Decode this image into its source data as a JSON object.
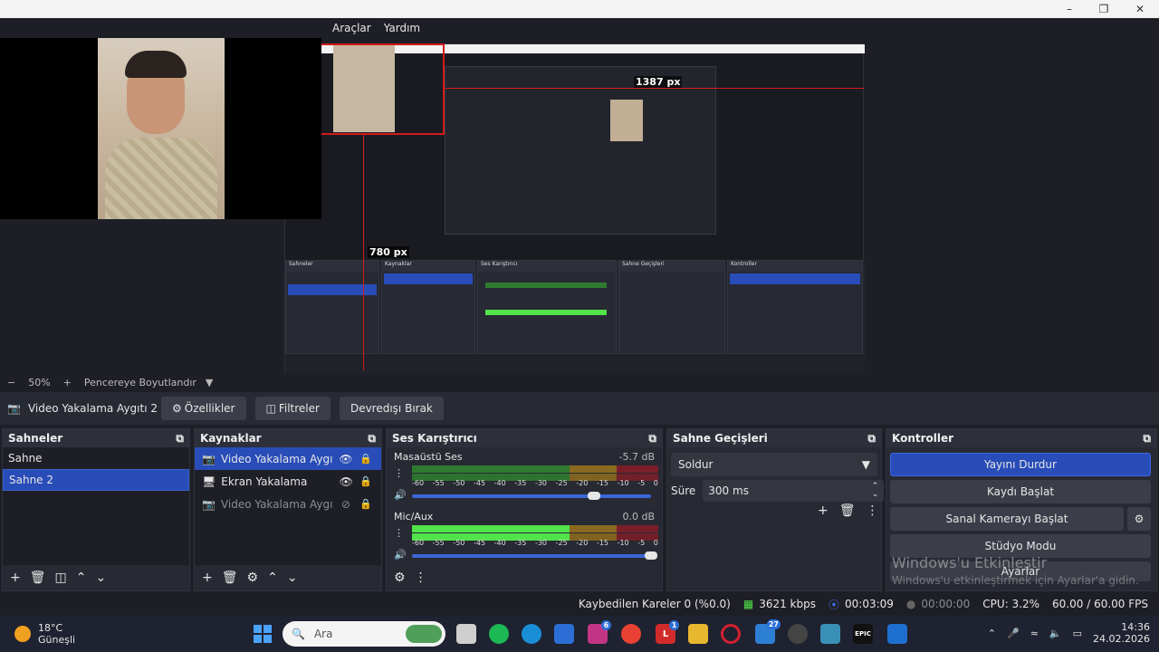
{
  "menu": {
    "tools": "Araçlar",
    "help": "Yardım"
  },
  "preview": {
    "size_label_h": "1387 px",
    "size_label_v": "780 px"
  },
  "zoom": {
    "minus": "−",
    "value": "50%",
    "plus": "+",
    "fit": "Pencereye Boyutlandır"
  },
  "source_toolbar": {
    "source_name": "Video Yakalama Aygıtı 2",
    "properties": "Özellikler",
    "filters": "Filtreler",
    "deactivate": "Devredışı Bırak"
  },
  "scenes": {
    "title": "Sahneler",
    "items": [
      "Sahne",
      "Sahne 2"
    ],
    "selected_index": 1
  },
  "sources": {
    "title": "Kaynaklar",
    "items": [
      {
        "label": "Video Yakalama Aygıtı 2",
        "icon": "camera-icon",
        "visible": true
      },
      {
        "label": "Ekran Yakalama",
        "icon": "monitor-icon",
        "visible": true
      },
      {
        "label": "Video Yakalama Aygıtı",
        "icon": "camera-icon",
        "visible": false
      }
    ]
  },
  "mixer": {
    "title": "Ses Karıştırıcı",
    "ticks": [
      "-60",
      "-55",
      "-50",
      "-45",
      "-40",
      "-35",
      "-30",
      "-25",
      "-20",
      "-15",
      "-10",
      "-5",
      "0"
    ],
    "channels": [
      {
        "name": "Masaüstü Ses",
        "db": "-5.7 dB",
        "level": 0.0,
        "volume": 0.76
      },
      {
        "name": "Mic/Aux",
        "db": "0.0 dB",
        "level": 0.64,
        "volume": 1.0
      }
    ]
  },
  "transitions": {
    "title": "Sahne Geçişleri",
    "selected": "Soldur",
    "duration_label": "Süre",
    "duration_value": "300 ms"
  },
  "controls": {
    "title": "Kontroller",
    "stop_stream": "Yayını Durdur",
    "start_record": "Kaydı Başlat",
    "virtual_cam": "Sanal Kamerayı Başlat",
    "studio_mode": "Stüdyo Modu",
    "settings": "Ayarlar",
    "watermark_title": "Windows'u Etkinleştir",
    "watermark_sub": "Windows'u etkinleştirmek için Ayarlar'a gidin."
  },
  "status": {
    "dropped_frames": "Kaybedilen Kareler 0 (%0.0)",
    "bitrate": "3621 kbps",
    "stream_time": "00:03:09",
    "record_time": "00:00:00",
    "cpu": "CPU: 3.2%",
    "fps": "60.00 / 60.00 FPS"
  },
  "taskbar": {
    "temp": "18°C",
    "weather": "Güneşli",
    "search": "Ara",
    "time": "14:36",
    "date": "24.02.2026",
    "badge_instagram": "6",
    "badge_l": "1",
    "badge_store": "27"
  },
  "colors": {
    "accent": "#284cb8",
    "bg": "#1e1f26",
    "panel": "#272a33",
    "red_guide": "#d21b1b"
  }
}
